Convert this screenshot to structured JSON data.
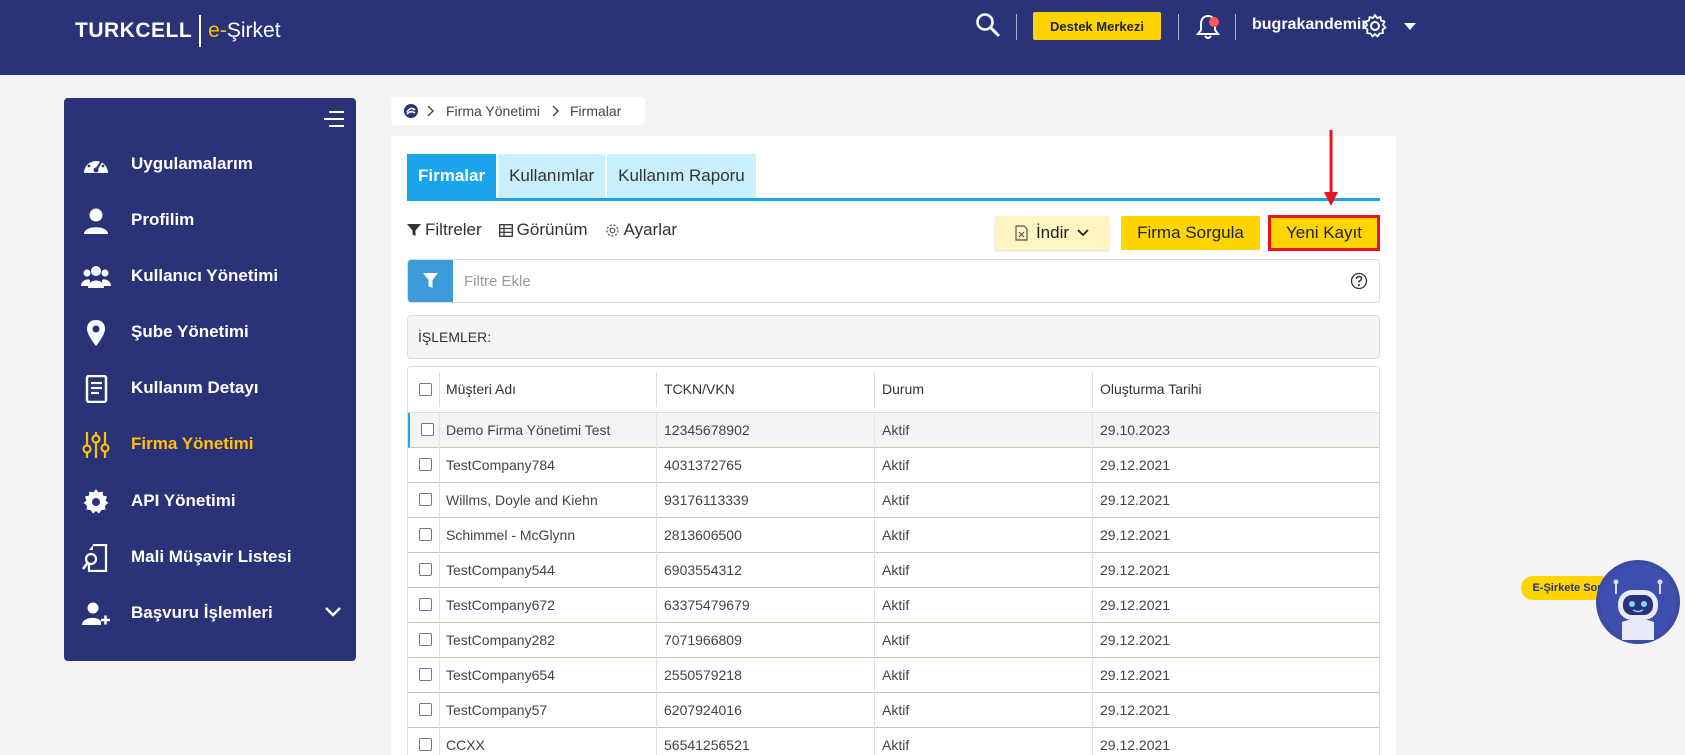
{
  "header": {
    "brand": "TURKCELL",
    "product_prefix": "e-",
    "product_name": "Şirket",
    "support_button": "Destek Merkezi",
    "username": "bugrakandemir"
  },
  "sidebar": {
    "items": [
      {
        "label": "Uygulamalarım",
        "icon": "dashboard-icon"
      },
      {
        "label": "Profilim",
        "icon": "user-icon"
      },
      {
        "label": "Kullanıcı Yönetimi",
        "icon": "users-icon"
      },
      {
        "label": "Şube Yönetimi",
        "icon": "location-pin-icon"
      },
      {
        "label": "Kullanım Detayı",
        "icon": "document-icon"
      },
      {
        "label": "Firma Yönetimi",
        "icon": "sliders-icon",
        "active": true
      },
      {
        "label": "API Yönetimi",
        "icon": "gear-icon"
      },
      {
        "label": "Mali Müşavir Listesi",
        "icon": "search-document-icon"
      },
      {
        "label": "Başvuru İşlemleri",
        "icon": "add-user-icon"
      }
    ]
  },
  "breadcrumb": {
    "level1": "Firma Yönetimi",
    "level2": "Firmalar"
  },
  "tabs": [
    {
      "label": "Firmalar",
      "active": true
    },
    {
      "label": "Kullanımlar"
    },
    {
      "label": "Kullanım Raporu"
    }
  ],
  "toolbar": {
    "filters": "Filtreler",
    "view": "Görünüm",
    "settings": "Ayarlar",
    "download": "İndir",
    "query": "Firma Sorgula",
    "new_record": "Yeni Kayıt"
  },
  "filter": {
    "placeholder": "Filtre Ekle"
  },
  "operations_label": "İŞLEMLER:",
  "table": {
    "columns": [
      "Müşteri Adı",
      "TCKN/VKN",
      "Durum",
      "Oluşturma Tarihi"
    ],
    "rows": [
      [
        "Demo Firma Yönetimi Test",
        "12345678902",
        "Aktif",
        "29.10.2023"
      ],
      [
        "TestCompany784",
        "4031372765",
        "Aktif",
        "29.12.2021"
      ],
      [
        "Willms, Doyle and Kiehn",
        "93176113339",
        "Aktif",
        "29.12.2021"
      ],
      [
        "Schimmel - McGlynn",
        "2813606500",
        "Aktif",
        "29.12.2021"
      ],
      [
        "TestCompany544",
        "6903554312",
        "Aktif",
        "29.12.2021"
      ],
      [
        "TestCompany672",
        "63375479679",
        "Aktif",
        "29.12.2021"
      ],
      [
        "TestCompany282",
        "7071966809",
        "Aktif",
        "29.12.2021"
      ],
      [
        "TestCompany654",
        "2550579218",
        "Aktif",
        "29.12.2021"
      ],
      [
        "TestCompany57",
        "6207924016",
        "Aktif",
        "29.12.2021"
      ],
      [
        "CCXX",
        "56541256521",
        "Aktif",
        "29.12.2021"
      ]
    ]
  },
  "chatbot": {
    "label": "E-Şirkete Sor"
  },
  "colors": {
    "navy": "#2a3378",
    "accent_blue": "#1aa4e9",
    "yellow": "#ffd500",
    "highlight_red": "#e8141b"
  }
}
